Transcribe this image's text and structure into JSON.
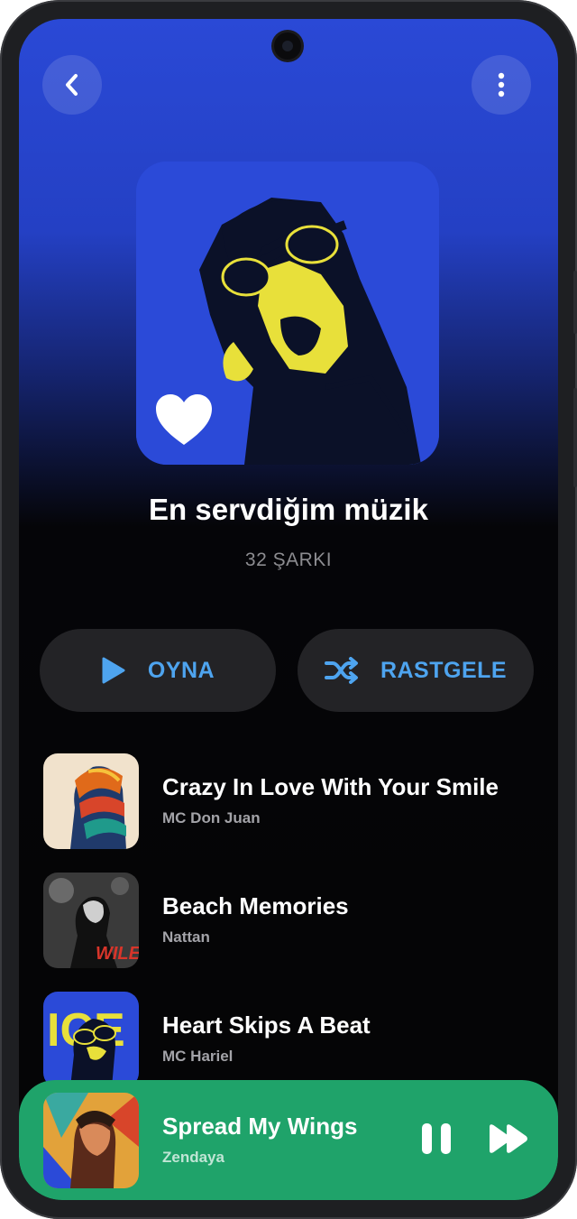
{
  "header": {
    "back_icon": "chevron-left-icon",
    "more_icon": "vertical-dots-icon"
  },
  "playlist": {
    "title": "En servdiğim müzik",
    "count": "32 ŞARKI",
    "cover_icon": "liked-heart-icon"
  },
  "actions": {
    "play_label": "OYNA",
    "shuffle_label": "RASTGELE",
    "accent": "#4ea4ef"
  },
  "songs": [
    {
      "title": "Crazy In Love With Your Smile",
      "artist": "MC Don Juan"
    },
    {
      "title": "Beach Memories",
      "artist": "Nattan"
    },
    {
      "title": "Heart Skips A Beat",
      "artist": "MC Hariel"
    }
  ],
  "now_playing": {
    "title": "Spread My Wings",
    "artist": "Zendaya",
    "background": "#1fa36a"
  },
  "cover_text": {
    "art2": "WILE",
    "art3": "ICE"
  }
}
